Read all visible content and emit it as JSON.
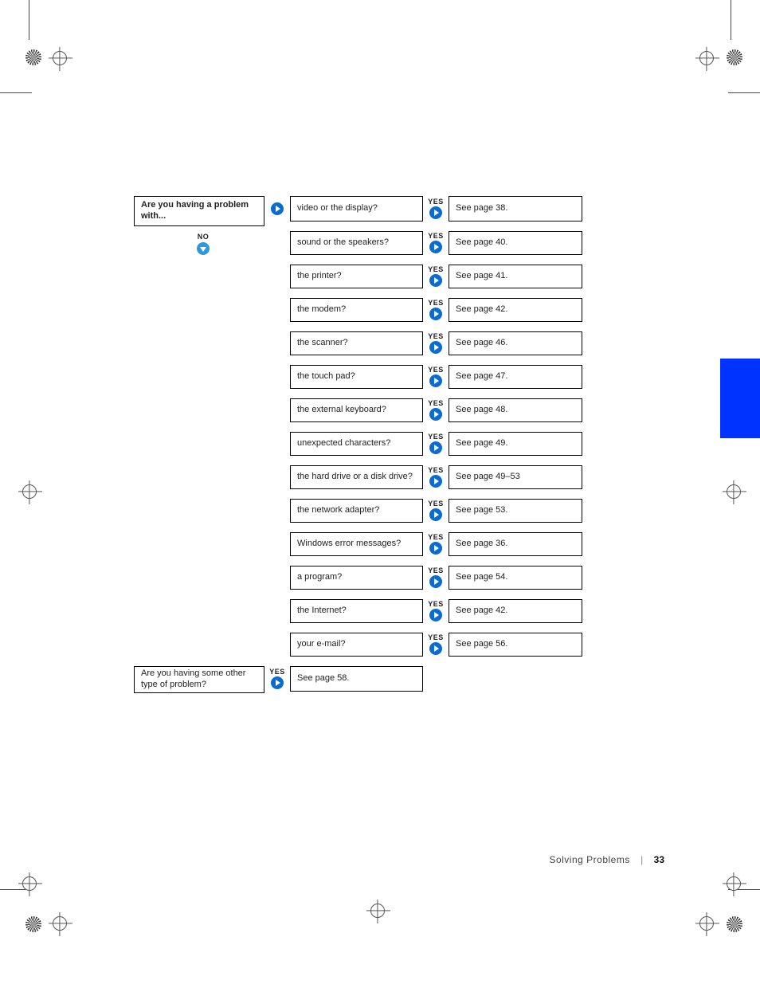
{
  "intro": {
    "question": "Are you having a problem with..."
  },
  "no_label": "NO",
  "yes_label": "YES",
  "problems": [
    {
      "q": "video or the display?",
      "a": "See page 38."
    },
    {
      "q": "sound or the speakers?",
      "a": "See page 40."
    },
    {
      "q": "the printer?",
      "a": "See page 41."
    },
    {
      "q": "the modem?",
      "a": "See page 42."
    },
    {
      "q": "the scanner?",
      "a": "See page 46."
    },
    {
      "q": "the touch pad?",
      "a": "See page 47."
    },
    {
      "q": "the external keyboard?",
      "a": "See page 48."
    },
    {
      "q": "unexpected characters?",
      "a": "See page 49."
    },
    {
      "q": "the hard drive or a disk drive?",
      "a": "See page 49–53"
    },
    {
      "q": "the network adapter?",
      "a": "See page 53."
    },
    {
      "q": "Windows error messages?",
      "a": "See page 36."
    },
    {
      "q": "a program?",
      "a": "See page 54."
    },
    {
      "q": "the Internet?",
      "a": "See page 42."
    },
    {
      "q": "your e-mail?",
      "a": "See page 56."
    }
  ],
  "other": {
    "question": "Are you having some other type of problem?",
    "answer": "See page 58."
  },
  "footer": {
    "section": "Solving Problems",
    "page": "33"
  }
}
